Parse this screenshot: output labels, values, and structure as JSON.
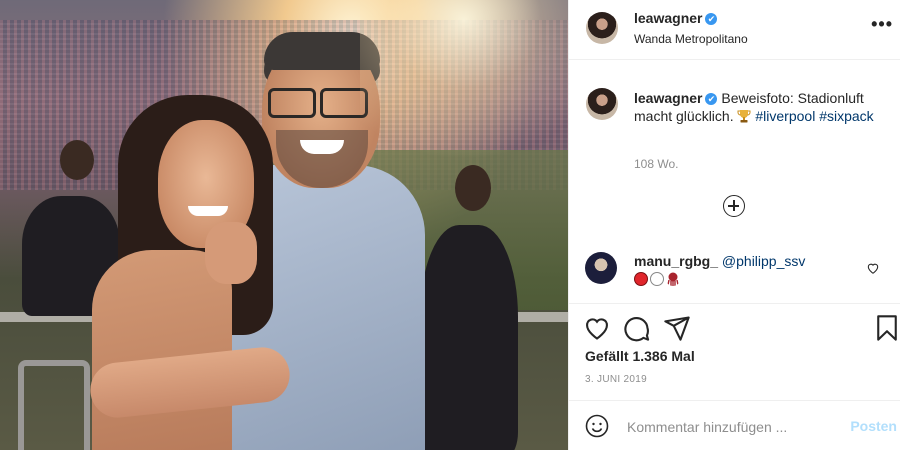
{
  "post": {
    "username": "leawagner",
    "verified": "✔",
    "location": "Wanda Metropolitano",
    "more": "•••",
    "caption": {
      "username": "leawagner",
      "text": "Beweisfoto: Stadionluft macht glücklich.",
      "emoji": "trophy",
      "hashtag1": "#liverpool",
      "hashtag2": "#sixpack"
    },
    "caption_age": "108 Wo."
  },
  "comment": {
    "username": "manu_rgbg_",
    "mention": "@philipp_ssv",
    "emoji": [
      "red-circle",
      "white-circle",
      "octopus"
    ]
  },
  "likes": "Gefällt 1.386 Mal",
  "date": "3. JUNI 2019",
  "add_comment": {
    "placeholder": "Kommentar hinzufügen ...",
    "post_label": "Posten"
  },
  "colors": {
    "link": "#00376b",
    "verified": "#3897f0",
    "post_disabled": "#b2dffc",
    "secondary_text": "#8e8e8e"
  }
}
